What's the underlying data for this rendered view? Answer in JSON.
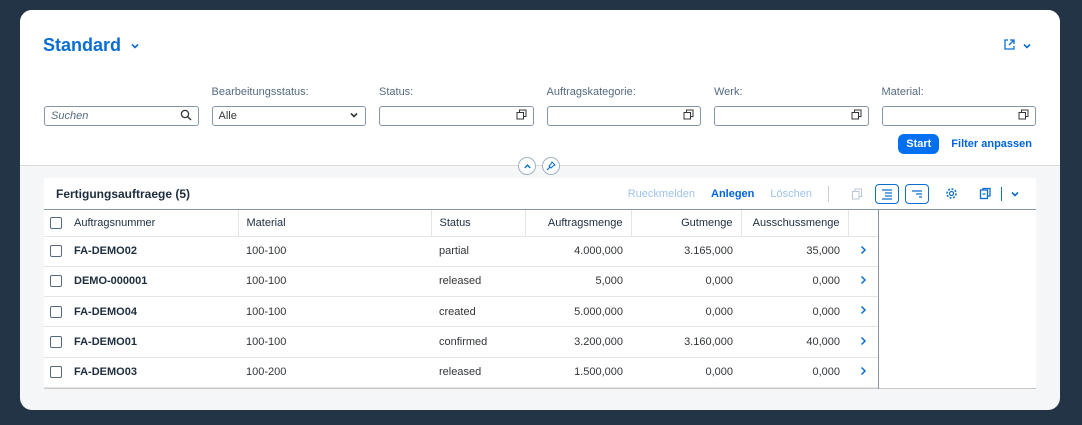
{
  "variant": {
    "title": "Standard"
  },
  "filters": {
    "search_placeholder": "Suchen",
    "items": [
      {
        "label": "Bearbeitungsstatus:",
        "value": "Alle"
      },
      {
        "label": "Status:",
        "value": ""
      },
      {
        "label": "Auftragskategorie:",
        "value": ""
      },
      {
        "label": "Werk:",
        "value": ""
      },
      {
        "label": "Material:",
        "value": ""
      }
    ],
    "start_label": "Start",
    "adapt_label": "Filter anpassen"
  },
  "table": {
    "title": "Fertigungsauftraege (5)",
    "actions": {
      "rueckmelden": "Rueckmelden",
      "anlegen": "Anlegen",
      "loeschen": "Löschen"
    },
    "columns": [
      "Auftragsnummer",
      "Material",
      "Status",
      "Auftragsmenge",
      "Gutmenge",
      "Ausschussmenge"
    ],
    "rows": [
      {
        "order": "FA-DEMO02",
        "material": "100-100",
        "status": "partial",
        "qty": "4.000,000",
        "good": "3.165,000",
        "scrap": "35,000"
      },
      {
        "order": "DEMO-000001",
        "material": "100-100",
        "status": "released",
        "qty": "5,000",
        "good": "0,000",
        "scrap": "0,000"
      },
      {
        "order": "FA-DEMO04",
        "material": "100-100",
        "status": "created",
        "qty": "5.000,000",
        "good": "0,000",
        "scrap": "0,000"
      },
      {
        "order": "FA-DEMO01",
        "material": "100-100",
        "status": "confirmed",
        "qty": "3.200,000",
        "good": "3.160,000",
        "scrap": "40,000"
      },
      {
        "order": "FA-DEMO03",
        "material": "100-200",
        "status": "released",
        "qty": "1.500,000",
        "good": "0,000",
        "scrap": "0,000"
      }
    ]
  }
}
